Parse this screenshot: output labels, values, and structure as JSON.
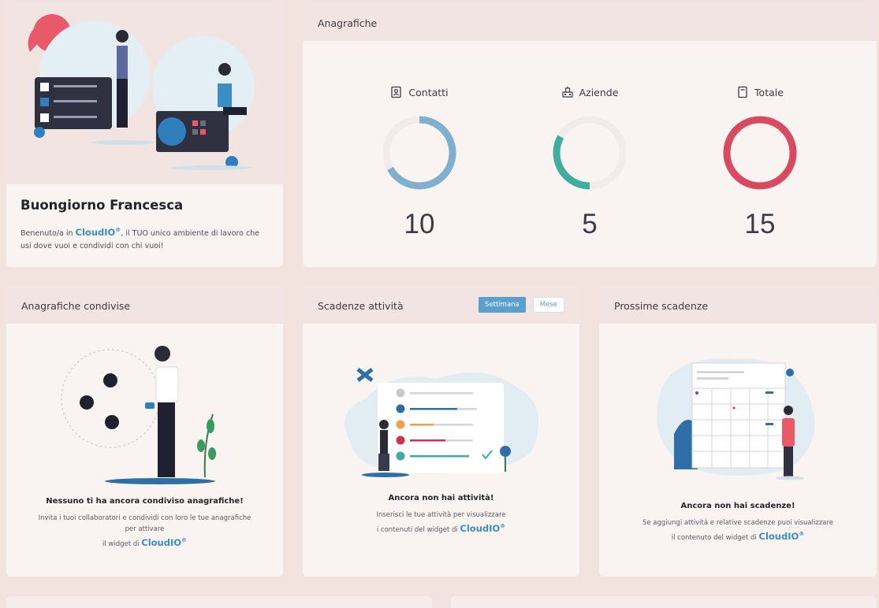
{
  "welcome": {
    "greeting": "Buongiorno Francesca",
    "text_before": "Benenuto/a in ",
    "brand": "CloudIO",
    "brand_mark": "®",
    "text_after": ", il TUO unico ambiente di lavoro che usi dove vuoi e condividi con chi vuoi!"
  },
  "anagrafiche": {
    "title": "Anagrafiche",
    "stats": [
      {
        "label": "Contatti",
        "value": "10",
        "fraction": 0.67,
        "color": "#7fb0cf",
        "icon": "contact-card-icon"
      },
      {
        "label": "Aziende",
        "value": "5",
        "fraction": 0.33,
        "color": "#3fae9f",
        "icon": "company-building-icon"
      },
      {
        "label": "Totale",
        "value": "15",
        "fraction": 1.0,
        "color": "#d94a60",
        "icon": "total-document-icon"
      }
    ]
  },
  "shared": {
    "title": "Anagrafiche condivise",
    "empty_title": "Nessuno ti ha ancora condiviso anagrafiche!",
    "empty_text_1": "Invita i tuoi collaboratori e condividi con loro le tue anagrafiche",
    "empty_text_2": "per attivare",
    "empty_text_3": "il widget di ",
    "brand": "CloudIO",
    "brand_mark": "®"
  },
  "deadlines": {
    "title": "Scadenze attività",
    "btn_week": "Settimana",
    "btn_month": "Mese",
    "empty_title": "Ancora non hai attività!",
    "empty_text_1": "Inserisci le tue attività per visualizzare",
    "empty_text_2": "i contenuti del widget di ",
    "brand": "CloudIO",
    "brand_mark": "®"
  },
  "next": {
    "title": "Prossime scadenze",
    "empty_title": "Ancora non hai scadenze!",
    "empty_text_1": "Se aggiungi attività e relative scadenze puoi visualizzare",
    "empty_text_2": "il contenuto del widget di ",
    "brand": "CloudIO",
    "brand_mark": "®"
  },
  "colors": {
    "accent": "#3a8ec4",
    "card_bg": "#f9f3f1",
    "header_bg": "#f1e4e1",
    "page_bg": "#f3e3de"
  }
}
